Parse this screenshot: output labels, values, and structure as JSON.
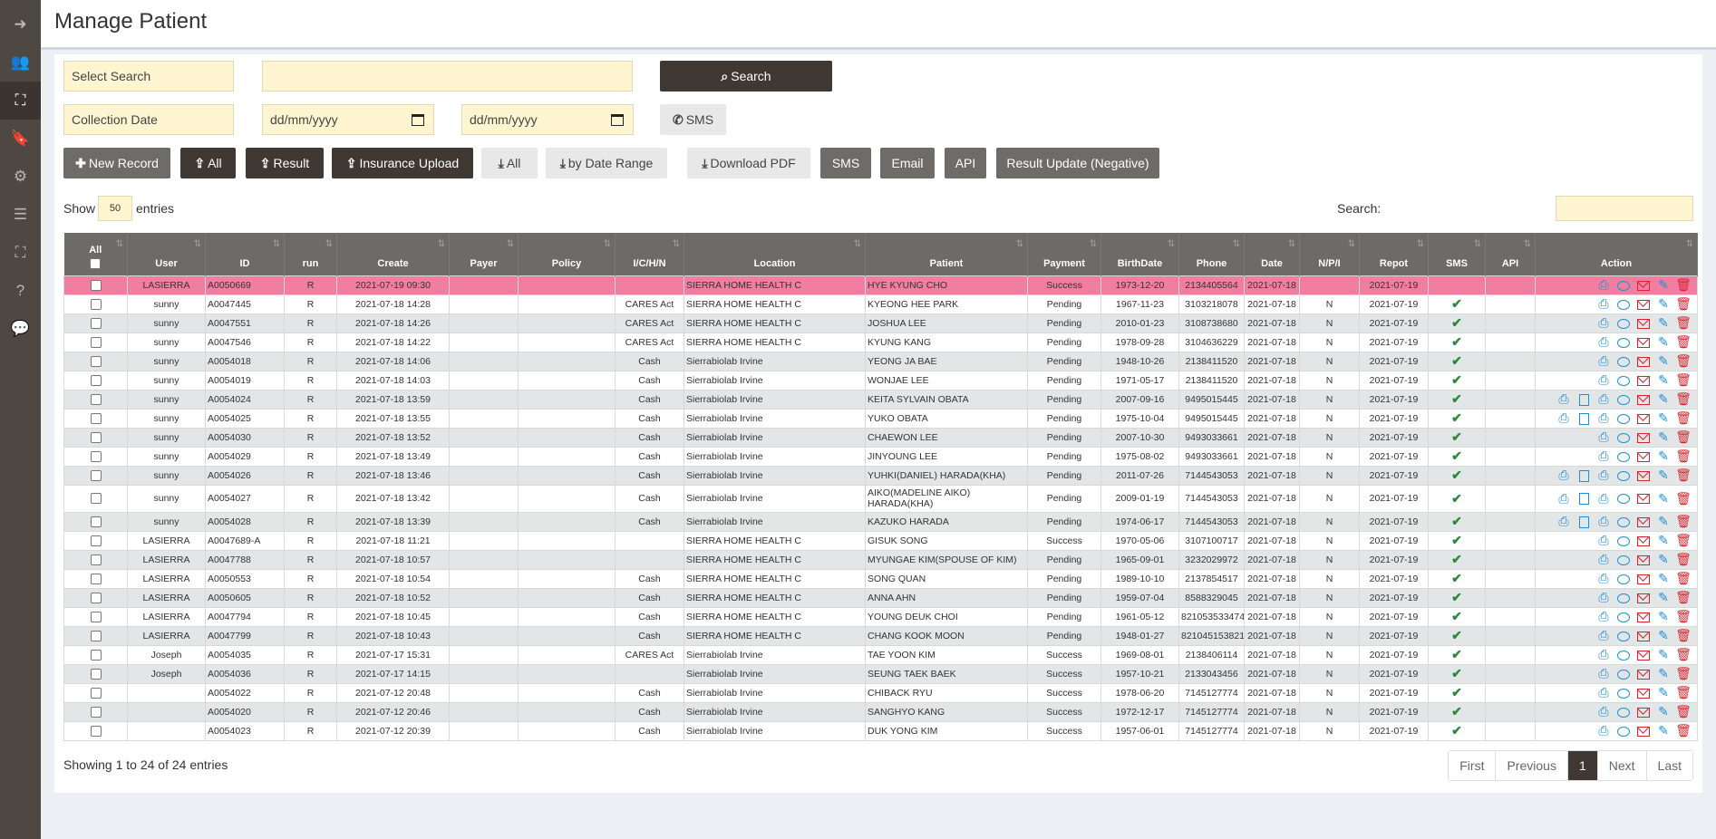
{
  "page": {
    "title": "Manage Patient"
  },
  "sidebar": [
    {
      "name": "sign-out-icon",
      "glyph": "➜"
    },
    {
      "name": "users-icon",
      "glyph": "👥"
    },
    {
      "name": "sitemap-icon",
      "glyph": "⛶"
    },
    {
      "name": "bookmark-icon",
      "glyph": "🔖"
    },
    {
      "name": "gear-icon",
      "glyph": "⚙"
    },
    {
      "name": "list-icon",
      "glyph": "☰"
    },
    {
      "name": "sitemap-icon-2",
      "glyph": "⛶"
    },
    {
      "name": "help-icon",
      "glyph": "?"
    },
    {
      "name": "comment-icon",
      "glyph": "💬"
    }
  ],
  "filters": {
    "select_search": "Select Search",
    "search_value": "",
    "search_btn": "Search",
    "collection_date": "Collection Date",
    "date_from": "dd/mm/yyyy",
    "date_to": "dd/mm/yyyy",
    "sms_btn": "SMS"
  },
  "toolbar": {
    "new_record": "New Record",
    "upload_all": "All",
    "upload_result": "Result",
    "insurance_upload": "Insurance Upload",
    "download_all": "All",
    "by_date_range": "by Date Range",
    "download_pdf": "Download PDF",
    "sms": "SMS",
    "email": "Email",
    "api": "API",
    "result_update": "Result Update (Negative)"
  },
  "table_controls": {
    "show": "Show",
    "entries_value": "50",
    "entries": "entries",
    "search_label": "Search:"
  },
  "columns": [
    "All",
    "User",
    "ID",
    "run",
    "Create",
    "Payer",
    "Policy",
    "I/C/H/N",
    "Location",
    "Patient",
    "Payment",
    "BirthDate",
    "Phone",
    "Date",
    "N/P/I",
    "Repot",
    "SMS",
    "API",
    "Action"
  ],
  "rows": [
    {
      "user": "LASIERRA",
      "id": "A0050669",
      "run": "R",
      "create": "2021-07-19 09:30",
      "payer": "",
      "policy": "",
      "ichn": "",
      "location": "SIERRA HOME HEALTH C",
      "patient": "HYE KYUNG CHO",
      "payment": "Success",
      "birth": "1973-12-20",
      "phone": "2134405564",
      "date": "2021-07-18",
      "npi": "",
      "repot": "2021-07-19",
      "sms": false,
      "api": "",
      "extra": false
    },
    {
      "user": "sunny",
      "id": "A0047445",
      "run": "R",
      "create": "2021-07-18 14:28",
      "payer": "",
      "policy": "",
      "ichn": "CARES Act",
      "location": "SIERRA HOME HEALTH C",
      "patient": "KYEONG HEE PARK",
      "payment": "Pending",
      "birth": "1967-11-23",
      "phone": "3103218078",
      "date": "2021-07-18",
      "npi": "N",
      "repot": "2021-07-19",
      "sms": true,
      "api": "",
      "extra": false
    },
    {
      "user": "sunny",
      "id": "A0047551",
      "run": "R",
      "create": "2021-07-18 14:26",
      "payer": "",
      "policy": "",
      "ichn": "CARES Act",
      "location": "SIERRA HOME HEALTH C",
      "patient": "JOSHUA LEE",
      "payment": "Pending",
      "birth": "2010-01-23",
      "phone": "3108738680",
      "date": "2021-07-18",
      "npi": "N",
      "repot": "2021-07-19",
      "sms": true,
      "api": "",
      "extra": false
    },
    {
      "user": "sunny",
      "id": "A0047546",
      "run": "R",
      "create": "2021-07-18 14:22",
      "payer": "",
      "policy": "",
      "ichn": "CARES Act",
      "location": "SIERRA HOME HEALTH C",
      "patient": "KYUNG KANG",
      "payment": "Pending",
      "birth": "1978-09-28",
      "phone": "3104636229",
      "date": "2021-07-18",
      "npi": "N",
      "repot": "2021-07-19",
      "sms": true,
      "api": "",
      "extra": false
    },
    {
      "user": "sunny",
      "id": "A0054018",
      "run": "R",
      "create": "2021-07-18 14:06",
      "payer": "",
      "policy": "",
      "ichn": "Cash",
      "location": "Sierrabiolab Irvine",
      "patient": "YEONG JA BAE",
      "payment": "Pending",
      "birth": "1948-10-26",
      "phone": "2138411520",
      "date": "2021-07-18",
      "npi": "N",
      "repot": "2021-07-19",
      "sms": true,
      "api": "",
      "extra": false
    },
    {
      "user": "sunny",
      "id": "A0054019",
      "run": "R",
      "create": "2021-07-18 14:03",
      "payer": "",
      "policy": "",
      "ichn": "Cash",
      "location": "Sierrabiolab Irvine",
      "patient": "WONJAE LEE",
      "payment": "Pending",
      "birth": "1971-05-17",
      "phone": "2138411520",
      "date": "2021-07-18",
      "npi": "N",
      "repot": "2021-07-19",
      "sms": true,
      "api": "",
      "extra": false
    },
    {
      "user": "sunny",
      "id": "A0054024",
      "run": "R",
      "create": "2021-07-18 13:59",
      "payer": "",
      "policy": "",
      "ichn": "Cash",
      "location": "Sierrabiolab Irvine",
      "patient": "KEITA SYLVAIN OBATA",
      "payment": "Pending",
      "birth": "2007-09-16",
      "phone": "9495015445",
      "date": "2021-07-18",
      "npi": "N",
      "repot": "2021-07-19",
      "sms": true,
      "api": "",
      "extra": true
    },
    {
      "user": "sunny",
      "id": "A0054025",
      "run": "R",
      "create": "2021-07-18 13:55",
      "payer": "",
      "policy": "",
      "ichn": "Cash",
      "location": "Sierrabiolab Irvine",
      "patient": "YUKO OBATA",
      "payment": "Pending",
      "birth": "1975-10-04",
      "phone": "9495015445",
      "date": "2021-07-18",
      "npi": "N",
      "repot": "2021-07-19",
      "sms": true,
      "api": "",
      "extra": true
    },
    {
      "user": "sunny",
      "id": "A0054030",
      "run": "R",
      "create": "2021-07-18 13:52",
      "payer": "",
      "policy": "",
      "ichn": "Cash",
      "location": "Sierrabiolab Irvine",
      "patient": "CHAEWON LEE",
      "payment": "Pending",
      "birth": "2007-10-30",
      "phone": "9493033661",
      "date": "2021-07-18",
      "npi": "N",
      "repot": "2021-07-19",
      "sms": true,
      "api": "",
      "extra": false
    },
    {
      "user": "sunny",
      "id": "A0054029",
      "run": "R",
      "create": "2021-07-18 13:49",
      "payer": "",
      "policy": "",
      "ichn": "Cash",
      "location": "Sierrabiolab Irvine",
      "patient": "JINYOUNG LEE",
      "payment": "Pending",
      "birth": "1975-08-02",
      "phone": "9493033661",
      "date": "2021-07-18",
      "npi": "N",
      "repot": "2021-07-19",
      "sms": true,
      "api": "",
      "extra": false
    },
    {
      "user": "sunny",
      "id": "A0054026",
      "run": "R",
      "create": "2021-07-18 13:46",
      "payer": "",
      "policy": "",
      "ichn": "Cash",
      "location": "Sierrabiolab Irvine",
      "patient": "YUHKI(DANIEL) HARADA(KHA)",
      "payment": "Pending",
      "birth": "2011-07-26",
      "phone": "7144543053",
      "date": "2021-07-18",
      "npi": "N",
      "repot": "2021-07-19",
      "sms": true,
      "api": "",
      "extra": true
    },
    {
      "user": "sunny",
      "id": "A0054027",
      "run": "R",
      "create": "2021-07-18 13:42",
      "payer": "",
      "policy": "",
      "ichn": "Cash",
      "location": "Sierrabiolab Irvine",
      "patient": "AIKO(MADELINE AIKO) HARADA(KHA)",
      "payment": "Pending",
      "birth": "2009-01-19",
      "phone": "7144543053",
      "date": "2021-07-18",
      "npi": "N",
      "repot": "2021-07-19",
      "sms": true,
      "api": "",
      "extra": true,
      "tall": true
    },
    {
      "user": "sunny",
      "id": "A0054028",
      "run": "R",
      "create": "2021-07-18 13:39",
      "payer": "",
      "policy": "",
      "ichn": "Cash",
      "location": "Sierrabiolab Irvine",
      "patient": "KAZUKO HARADA",
      "payment": "Pending",
      "birth": "1974-06-17",
      "phone": "7144543053",
      "date": "2021-07-18",
      "npi": "N",
      "repot": "2021-07-19",
      "sms": true,
      "api": "",
      "extra": true
    },
    {
      "user": "LASIERRA",
      "id": "A0047689-A",
      "run": "R",
      "create": "2021-07-18 11:21",
      "payer": "",
      "policy": "",
      "ichn": "",
      "location": "SIERRA HOME HEALTH C",
      "patient": "GISUK SONG",
      "payment": "Success",
      "birth": "1970-05-06",
      "phone": "3107100717",
      "date": "2021-07-18",
      "npi": "N",
      "repot": "2021-07-19",
      "sms": true,
      "api": "",
      "extra": false
    },
    {
      "user": "LASIERRA",
      "id": "A0047788",
      "run": "R",
      "create": "2021-07-18 10:57",
      "payer": "",
      "policy": "",
      "ichn": "",
      "location": "SIERRA HOME HEALTH C",
      "patient": "MYUNGAE KIM(SPOUSE OF KIM)",
      "payment": "Pending",
      "birth": "1965-09-01",
      "phone": "3232029972",
      "date": "2021-07-18",
      "npi": "N",
      "repot": "2021-07-19",
      "sms": true,
      "api": "",
      "extra": false
    },
    {
      "user": "LASIERRA",
      "id": "A0050553",
      "run": "R",
      "create": "2021-07-18 10:54",
      "payer": "",
      "policy": "",
      "ichn": "Cash",
      "location": "SIERRA HOME HEALTH C",
      "patient": "SONG QUAN",
      "payment": "Pending",
      "birth": "1989-10-10",
      "phone": "2137854517",
      "date": "2021-07-18",
      "npi": "N",
      "repot": "2021-07-19",
      "sms": true,
      "api": "",
      "extra": false
    },
    {
      "user": "LASIERRA",
      "id": "A0050605",
      "run": "R",
      "create": "2021-07-18 10:52",
      "payer": "",
      "policy": "",
      "ichn": "Cash",
      "location": "SIERRA HOME HEALTH C",
      "patient": "ANNA AHN",
      "payment": "Pending",
      "birth": "1959-07-04",
      "phone": "8588329045",
      "date": "2021-07-18",
      "npi": "N",
      "repot": "2021-07-19",
      "sms": true,
      "api": "",
      "extra": false
    },
    {
      "user": "LASIERRA",
      "id": "A0047794",
      "run": "R",
      "create": "2021-07-18 10:45",
      "payer": "",
      "policy": "",
      "ichn": "Cash",
      "location": "SIERRA HOME HEALTH C",
      "patient": "YOUNG DEUK CHOI",
      "payment": "Pending",
      "birth": "1961-05-12",
      "phone": "821053533474",
      "date": "2021-07-18",
      "npi": "N",
      "repot": "2021-07-19",
      "sms": true,
      "api": "",
      "extra": false
    },
    {
      "user": "LASIERRA",
      "id": "A0047799",
      "run": "R",
      "create": "2021-07-18 10:43",
      "payer": "",
      "policy": "",
      "ichn": "Cash",
      "location": "SIERRA HOME HEALTH C",
      "patient": "CHANG KOOK MOON",
      "payment": "Pending",
      "birth": "1948-01-27",
      "phone": "821045153821",
      "date": "2021-07-18",
      "npi": "N",
      "repot": "2021-07-19",
      "sms": true,
      "api": "",
      "extra": false
    },
    {
      "user": "Joseph",
      "id": "A0054035",
      "run": "R",
      "create": "2021-07-17 15:31",
      "payer": "",
      "policy": "",
      "ichn": "CARES Act",
      "location": "Sierrabiolab Irvine",
      "patient": "TAE YOON KIM",
      "payment": "Success",
      "birth": "1969-08-01",
      "phone": "2138406114",
      "date": "2021-07-18",
      "npi": "N",
      "repot": "2021-07-19",
      "sms": true,
      "api": "",
      "extra": false
    },
    {
      "user": "Joseph",
      "id": "A0054036",
      "run": "R",
      "create": "2021-07-17 14:15",
      "payer": "",
      "policy": "",
      "ichn": "",
      "location": "Sierrabiolab Irvine",
      "patient": "SEUNG TAEK BAEK",
      "payment": "Success",
      "birth": "1957-10-21",
      "phone": "2133043456",
      "date": "2021-07-18",
      "npi": "N",
      "repot": "2021-07-19",
      "sms": true,
      "api": "",
      "extra": false
    },
    {
      "user": "",
      "id": "A0054022",
      "run": "R",
      "create": "2021-07-12 20:48",
      "payer": "",
      "policy": "",
      "ichn": "Cash",
      "location": "Sierrabiolab Irvine",
      "patient": "CHIBACK RYU",
      "payment": "Success",
      "birth": "1978-06-20",
      "phone": "7145127774",
      "date": "2021-07-18",
      "npi": "N",
      "repot": "2021-07-19",
      "sms": true,
      "api": "",
      "extra": false
    },
    {
      "user": "",
      "id": "A0054020",
      "run": "R",
      "create": "2021-07-12 20:46",
      "payer": "",
      "policy": "",
      "ichn": "Cash",
      "location": "Sierrabiolab Irvine",
      "patient": "SANGHYO KANG",
      "payment": "Success",
      "birth": "1972-12-17",
      "phone": "7145127774",
      "date": "2021-07-18",
      "npi": "N",
      "repot": "2021-07-19",
      "sms": true,
      "api": "",
      "extra": false
    },
    {
      "user": "",
      "id": "A0054023",
      "run": "R",
      "create": "2021-07-12 20:39",
      "payer": "",
      "policy": "",
      "ichn": "Cash",
      "location": "Sierrabiolab Irvine",
      "patient": "DUK YONG KIM",
      "payment": "Success",
      "birth": "1957-06-01",
      "phone": "7145127774",
      "date": "2021-07-18",
      "npi": "N",
      "repot": "2021-07-19",
      "sms": true,
      "api": "",
      "extra": false
    }
  ],
  "footer": {
    "info": "Showing 1 to 24 of 24 entries",
    "pager": [
      "First",
      "Previous",
      "1",
      "Next",
      "Last"
    ],
    "active_page": "1"
  },
  "colors": {
    "highlight_row": "#f07ea0",
    "dark_button": "#3f3833",
    "sidebar": "#4e4843"
  }
}
